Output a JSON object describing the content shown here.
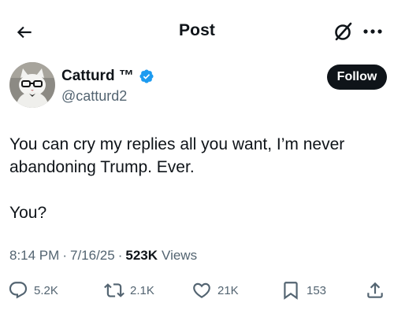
{
  "header": {
    "title": "Post"
  },
  "author": {
    "name": "Catturd ™",
    "handle": "@catturd2",
    "verified": true,
    "verified_color": "#1d9bf0"
  },
  "follow_label": "Follow",
  "post": {
    "lines": [
      "You can cry my replies all you want, I’m never",
      "abandoning Trump. Ever.",
      "You?"
    ]
  },
  "meta": {
    "time": "8:14 PM",
    "dot1": "·",
    "date": "7/16/25",
    "dot2": "·",
    "views": "523K",
    "views_label": "Views"
  },
  "actions": {
    "replies": "5.2K",
    "reposts": "2.1K",
    "likes": "21K",
    "bookmarks": "153"
  },
  "colors": {
    "text": "#0f1419",
    "secondary": "#536471",
    "verified": "#1d9bf0"
  }
}
